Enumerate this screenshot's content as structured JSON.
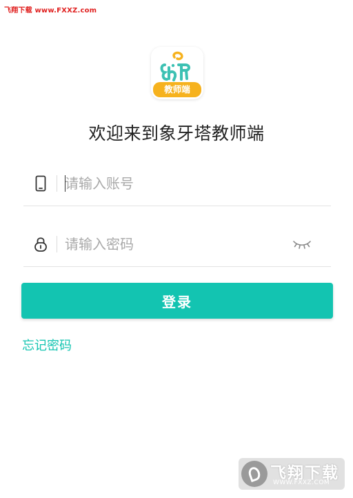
{
  "watermark_top": "飞翔下载 www.FXXZ.com",
  "logo": {
    "badge_text": "教师端",
    "accent_color": "#f6b21e",
    "brand_color": "#3dc1b3"
  },
  "title": "欢迎来到象牙塔教师端",
  "account": {
    "icon": "phone-icon",
    "placeholder": "请输入账号",
    "value": ""
  },
  "password": {
    "icon": "lock-icon",
    "placeholder": "请输入密码",
    "value": "",
    "toggle_icon": "eye-closed-icon"
  },
  "login_label": "登录",
  "forgot_label": "忘记密码",
  "watermark_bottom": {
    "name": "飞翔下载",
    "url": "WWW.FXXZ.COM"
  },
  "colors": {
    "primary": "#13c4b1",
    "divider": "#e2e2e2",
    "watermark_red": "#e0201f"
  }
}
